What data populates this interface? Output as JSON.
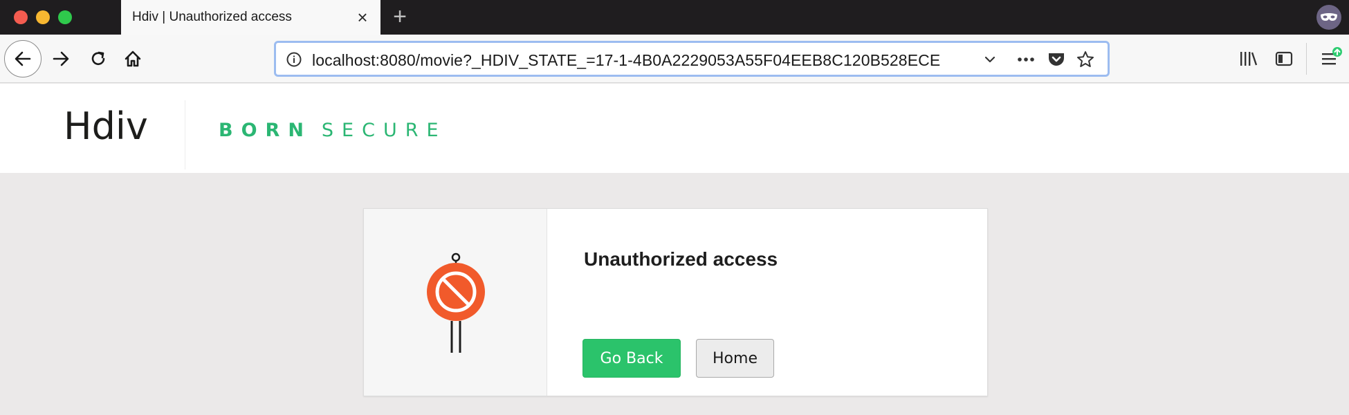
{
  "browser": {
    "tab_title": "Hdiv | Unauthorized access",
    "close_glyph": "×",
    "new_tab_glyph": "+",
    "url": "localhost:8080/movie?_HDIV_STATE_=17-1-4B0A2229053A55F04EEB8C120B528ECE",
    "icons": [
      "back-arrow-icon",
      "forward-arrow-icon",
      "reload-icon",
      "home-icon",
      "info-icon",
      "chevron-down-icon",
      "more-actions-icon",
      "pocket-icon",
      "bookmark-star-icon",
      "library-icon",
      "sidebar-icon",
      "menu-icon",
      "private-mask-icon",
      "update-badge-icon"
    ]
  },
  "site": {
    "logo_text": "Hdiv",
    "tagline_bold": "BORN",
    "tagline_light": "SECURE",
    "accent_color": "#2bb673"
  },
  "card": {
    "title": "Unauthorized access",
    "icon": "no-entry-sign-icon",
    "go_back_label": "Go Back",
    "home_label": "Home",
    "primary_color": "#2bc36b",
    "sign_color": "#f15a2b"
  }
}
